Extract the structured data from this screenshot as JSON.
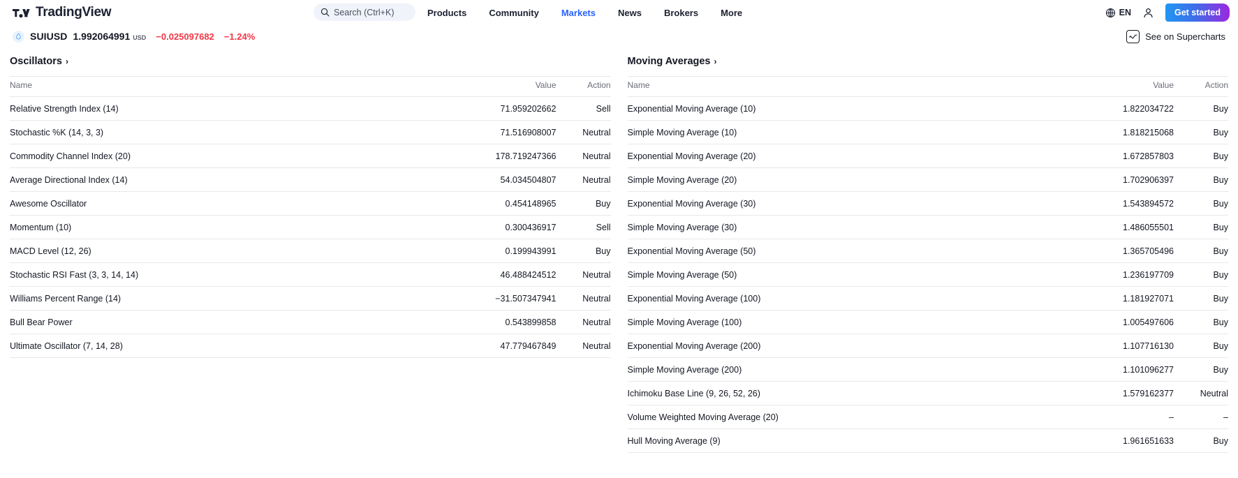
{
  "header": {
    "logo_text": "TradingView",
    "search": {
      "placeholder": "Search (Ctrl+K)",
      "icon": "search-icon"
    },
    "nav": [
      {
        "label": "Products",
        "active": false
      },
      {
        "label": "Community",
        "active": false
      },
      {
        "label": "Markets",
        "active": true
      },
      {
        "label": "News",
        "active": false
      },
      {
        "label": "Brokers",
        "active": false
      },
      {
        "label": "More",
        "active": false
      }
    ],
    "language": {
      "label": "EN",
      "icon": "globe-icon"
    },
    "account_icon": "user-avatar-icon",
    "cta": {
      "label": "Get started",
      "accent_from": "#2196f3",
      "accent_to": "#9c27e0"
    }
  },
  "ticker": {
    "icon": "sui-coin-icon",
    "symbol": "SUIUSD",
    "price": "1.992064991",
    "currency": "USD",
    "change_abs": "−0.025097682",
    "change_pct": "−1.24%",
    "change_color": "#f23645",
    "supercharts_label": "See on Supercharts",
    "supercharts_icon": "chart-line-icon"
  },
  "columns": {
    "name": "Name",
    "value": "Value",
    "action": "Action"
  },
  "oscillators": {
    "title": "Oscillators",
    "caret": "›",
    "rows": [
      {
        "name": "Relative Strength Index (14)",
        "value": "71.959202662",
        "action": "Sell",
        "tone": "sell"
      },
      {
        "name": "Stochastic %K (14, 3, 3)",
        "value": "71.516908007",
        "action": "Neutral",
        "tone": "neutral"
      },
      {
        "name": "Commodity Channel Index (20)",
        "value": "178.719247366",
        "action": "Neutral",
        "tone": "neutral"
      },
      {
        "name": "Average Directional Index (14)",
        "value": "54.034504807",
        "action": "Neutral",
        "tone": "neutral"
      },
      {
        "name": "Awesome Oscillator",
        "value": "0.454148965",
        "action": "Buy",
        "tone": "buy"
      },
      {
        "name": "Momentum (10)",
        "value": "0.300436917",
        "action": "Sell",
        "tone": "sell"
      },
      {
        "name": "MACD Level (12, 26)",
        "value": "0.199943991",
        "action": "Buy",
        "tone": "buy"
      },
      {
        "name": "Stochastic RSI Fast (3, 3, 14, 14)",
        "value": "46.488424512",
        "action": "Neutral",
        "tone": "neutral"
      },
      {
        "name": "Williams Percent Range (14)",
        "value": "−31.507347941",
        "action": "Neutral",
        "tone": "neutral"
      },
      {
        "name": "Bull Bear Power",
        "value": "0.543899858",
        "action": "Neutral",
        "tone": "neutral"
      },
      {
        "name": "Ultimate Oscillator (7, 14, 28)",
        "value": "47.779467849",
        "action": "Neutral",
        "tone": "neutral"
      }
    ]
  },
  "moving_averages": {
    "title": "Moving Averages",
    "caret": "›",
    "rows": [
      {
        "name": "Exponential Moving Average (10)",
        "value": "1.822034722",
        "action": "Buy",
        "tone": "buy"
      },
      {
        "name": "Simple Moving Average (10)",
        "value": "1.818215068",
        "action": "Buy",
        "tone": "buy"
      },
      {
        "name": "Exponential Moving Average (20)",
        "value": "1.672857803",
        "action": "Buy",
        "tone": "buy"
      },
      {
        "name": "Simple Moving Average (20)",
        "value": "1.702906397",
        "action": "Buy",
        "tone": "buy"
      },
      {
        "name": "Exponential Moving Average (30)",
        "value": "1.543894572",
        "action": "Buy",
        "tone": "buy"
      },
      {
        "name": "Simple Moving Average (30)",
        "value": "1.486055501",
        "action": "Buy",
        "tone": "buy"
      },
      {
        "name": "Exponential Moving Average (50)",
        "value": "1.365705496",
        "action": "Buy",
        "tone": "buy"
      },
      {
        "name": "Simple Moving Average (50)",
        "value": "1.236197709",
        "action": "Buy",
        "tone": "buy"
      },
      {
        "name": "Exponential Moving Average (100)",
        "value": "1.181927071",
        "action": "Buy",
        "tone": "buy"
      },
      {
        "name": "Simple Moving Average (100)",
        "value": "1.005497606",
        "action": "Buy",
        "tone": "buy"
      },
      {
        "name": "Exponential Moving Average (200)",
        "value": "1.107716130",
        "action": "Buy",
        "tone": "buy"
      },
      {
        "name": "Simple Moving Average (200)",
        "value": "1.101096277",
        "action": "Buy",
        "tone": "buy"
      },
      {
        "name": "Ichimoku Base Line (9, 26, 52, 26)",
        "value": "1.579162377",
        "action": "Neutral",
        "tone": "neutral"
      },
      {
        "name": "Volume Weighted Moving Average (20)",
        "value": "–",
        "action": "–",
        "tone": "none"
      },
      {
        "name": "Hull Moving Average (9)",
        "value": "1.961651633",
        "action": "Buy",
        "tone": "buy"
      }
    ]
  }
}
